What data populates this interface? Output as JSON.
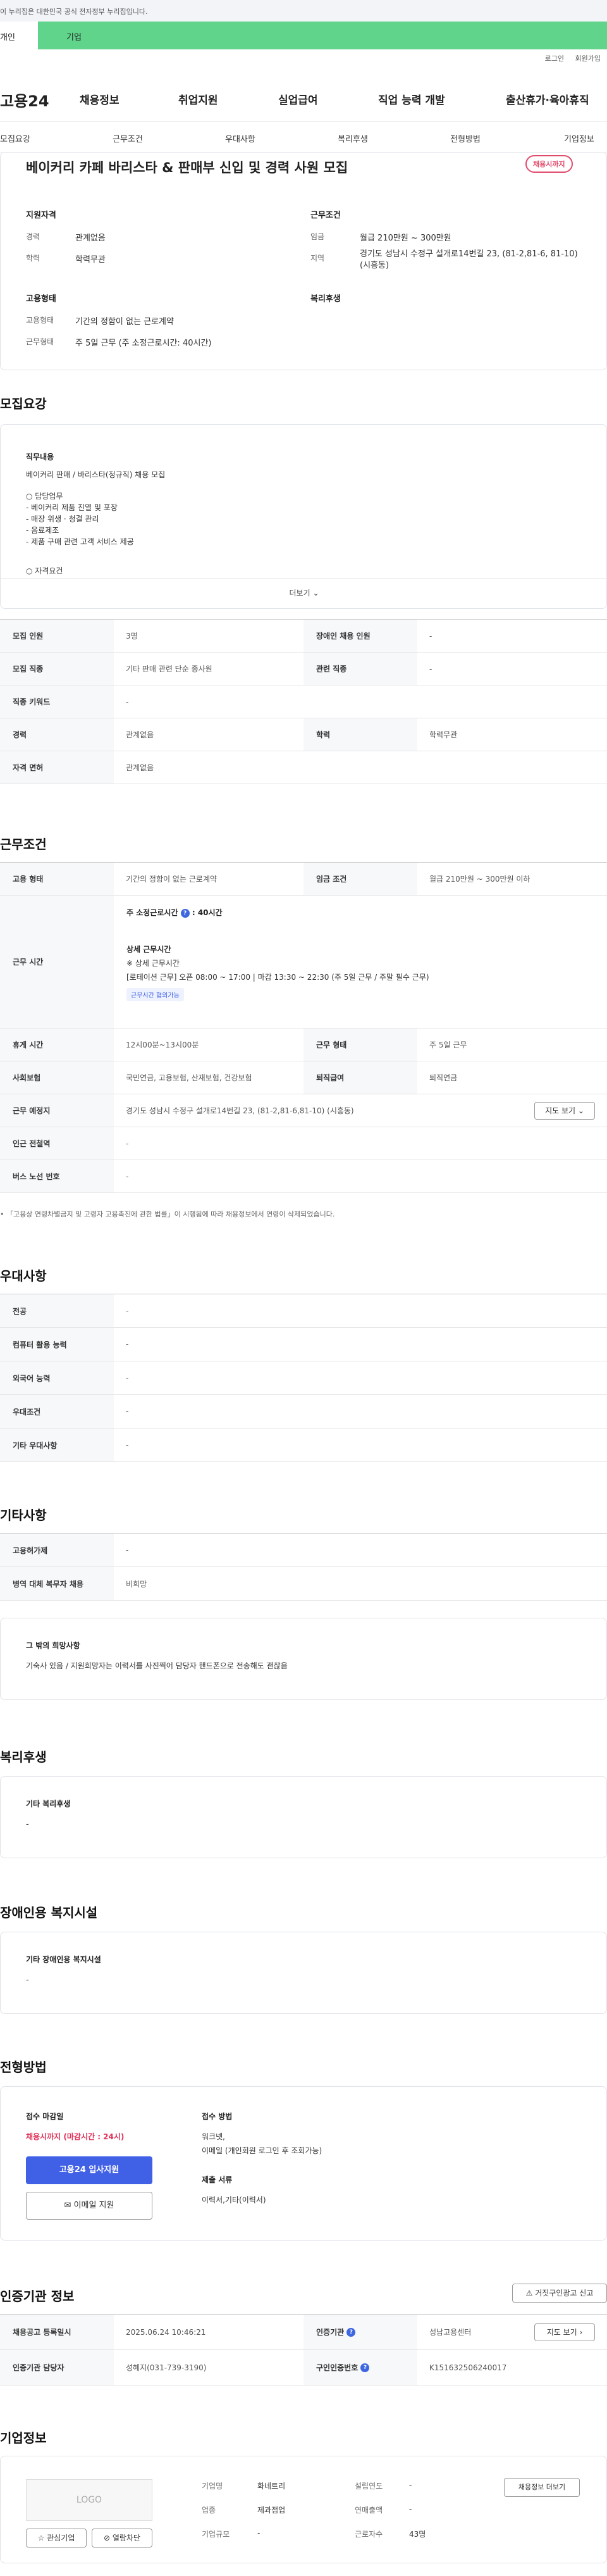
{
  "gov_notice": "이 누리집은 대한민국 공식 전자정부 누리집입니다.",
  "audience_tabs": {
    "personal": "개인",
    "company": "기업"
  },
  "util": {
    "login": "로그인",
    "signup": "회원가입"
  },
  "gnb": {
    "logo": "고용24",
    "items": [
      "채용정보",
      "취업지원",
      "실업급여",
      "직업 능력 개발",
      "출산휴가·육아휴직"
    ]
  },
  "subnav": [
    "모집요강",
    "근무조건",
    "우대사항",
    "복리후생",
    "전형방법",
    "기업정보"
  ],
  "summary": {
    "title": "베이커리 카페 바리스타 & 판매부 신입 및 경력 사원 모집",
    "status_badge": "채용시까지",
    "qual_h": "지원자격",
    "career_l": "경력",
    "career_v": "관계없음",
    "edu_l": "학력",
    "edu_v": "학력무관",
    "cond_h": "근무조건",
    "wage_l": "임금",
    "wage_v": "월급 210만원 ~ 300만원",
    "area_l": "지역",
    "area_v": "경기도 성남시 수정구 설개로14번길 23, (81-2,81-6, 81-10) (시흥동)",
    "emp_h": "고용형태",
    "emptype_l": "고용형태",
    "emptype_v": "기간의 정함이 없는 근로계약",
    "worktype_l": "근무형태",
    "worktype_v": "주 5일 근무 (주 소정근로시간: 40시간)",
    "welfare_h": "복리후생"
  },
  "recruit": {
    "heading": "모집요강",
    "job_h": "직무내용",
    "job_line": "베이커리 판매 / 바리스타(정규직) 채용 모집",
    "duty_h": "○ 담당업무",
    "duties": [
      "- 베이커리 제품 진열 및 포장",
      "- 매장 위생 · 청결 관리",
      "- 음료제조",
      "- 제품 구매 관련 고객 서비스 제공"
    ],
    "req_h": "○ 자격요건",
    "more": "더보기",
    "table": {
      "headcount_l": "모집 인원",
      "headcount_v": "3명",
      "disabled_l": "장애인 채용 인원",
      "disabled_v": "-",
      "job_l": "모집 직종",
      "job_v": "기타 판매 관련 단순 종사원",
      "related_l": "관련 직종",
      "related_v": "-",
      "keyword_l": "직종 키워드",
      "keyword_v": "-",
      "career_l": "경력",
      "career_v": "관계없음",
      "edu_l": "학력",
      "edu_v": "학력무관",
      "license_l": "자격 면허",
      "license_v": "관계없음"
    }
  },
  "conditions": {
    "heading": "근무조건",
    "emptype_l": "고용 형태",
    "emptype_v": "기간의 정함이 없는 근로계약",
    "wage_l": "임금 조건",
    "wage_v": "월급 210만원 ~ 300만원 이하",
    "hours_l": "근무 시간",
    "hours_total": "주 소정근로시간",
    "hours_total_v": ": 40시간",
    "hours_detail_h": "상세 근무시간",
    "hours_detail_sub": "※ 상세 근무시간",
    "hours_detail": "[로테이션 근무] 오픈 08:00 ~ 17:00  |  마감 13:30 ~ 22:30  (주 5일 근무 / 주말 필수 근무)",
    "hours_tag": "근무시간 협의가능",
    "break_l": "휴게 시간",
    "break_v": "12시00분~13시00분",
    "worktype_l": "근무 형태",
    "worktype_v": "주 5일 근무",
    "insurance_l": "사회보험",
    "insurance_v": "국민연금, 고용보험, 산재보험, 건강보험",
    "retire_l": "퇴직급여",
    "retire_v": "퇴직연금",
    "place_l": "근무 예정지",
    "place_v": "경기도 성남시 수정구 설개로14번길 23, (81-2,81-6,81-10) (시흥동)",
    "map_btn": "지도 보기",
    "subway_l": "인근 전철역",
    "subway_v": "-",
    "bus_l": "버스 노선 번호",
    "bus_v": "-",
    "footnote": "「고용상 연령차별금지 및 고령자 고용촉진에 관한 법률」이 시행됨에 따라 채용정보에서 연령이 삭제되었습니다."
  },
  "preference": {
    "heading": "우대사항",
    "rows": [
      {
        "l": "전공",
        "v": "-"
      },
      {
        "l": "컴퓨터 활용 능력",
        "v": "-"
      },
      {
        "l": "외국어 능력",
        "v": "-"
      },
      {
        "l": "우대조건",
        "v": "-"
      },
      {
        "l": "기타 우대사항",
        "v": "-"
      }
    ]
  },
  "other": {
    "heading": "기타사항",
    "rows": [
      {
        "l": "고용허가제",
        "v": "-"
      },
      {
        "l": "병역 대체 복무자 채용",
        "v": "비희망"
      }
    ],
    "box_h": "그 밖의 희망사항",
    "box_v": "기숙사 있음 / 지원희망자는 이력서를 사진찍어 담당자 핸드폰으로 전송해도 괜찮음"
  },
  "welfare": {
    "heading": "복리후생",
    "box_h": "기타 복리후생",
    "box_v": "-"
  },
  "disabled_fac": {
    "heading": "장애인용 복지시설",
    "box_h": "기타 장애인용 복지시설",
    "box_v": "-"
  },
  "selection": {
    "heading": "전형방법",
    "deadline_h": "접수 마감일",
    "deadline_v": "채용시까지 (마감시간 : 24시)",
    "apply_btn": "고용24 입사지원",
    "email_btn": "이메일 지원",
    "method_h": "접수 방법",
    "method_v1": "워크넷,",
    "method_v2": "이메일 (개인회원 로그인 후 조회가능)",
    "docs_h": "제출 서류",
    "docs_v": "이력서,기타(이력서)"
  },
  "cert": {
    "heading": "인증기관 정보",
    "report_btn": "거짓구인광고 신고",
    "reg_l": "채용공고 등록일시",
    "reg_v": "2025.06.24 10:46:21",
    "agency_l": "인증기관",
    "agency_v": "성남고용센터",
    "map_btn": "지도 보기",
    "manager_l": "인증기관 담당자",
    "manager_v": "성혜지(031-739-3190)",
    "authno_l": "구인인증번호",
    "authno_v": "K151632506240017"
  },
  "company": {
    "heading": "기업정보",
    "logo_placeholder": "LOGO",
    "interest_btn": "관심기업",
    "block_btn": "열람차단",
    "name_l": "기업명",
    "name_v": "화네트리",
    "industry_l": "업종",
    "industry_v": "제과점업",
    "size_l": "기업규모",
    "size_v": "-",
    "founded_l": "설립연도",
    "founded_v": "-",
    "sales_l": "연매출액",
    "sales_v": "-",
    "emp_l": "근로자수",
    "emp_v": "43명",
    "info_btn": "채용정보 더보기"
  }
}
